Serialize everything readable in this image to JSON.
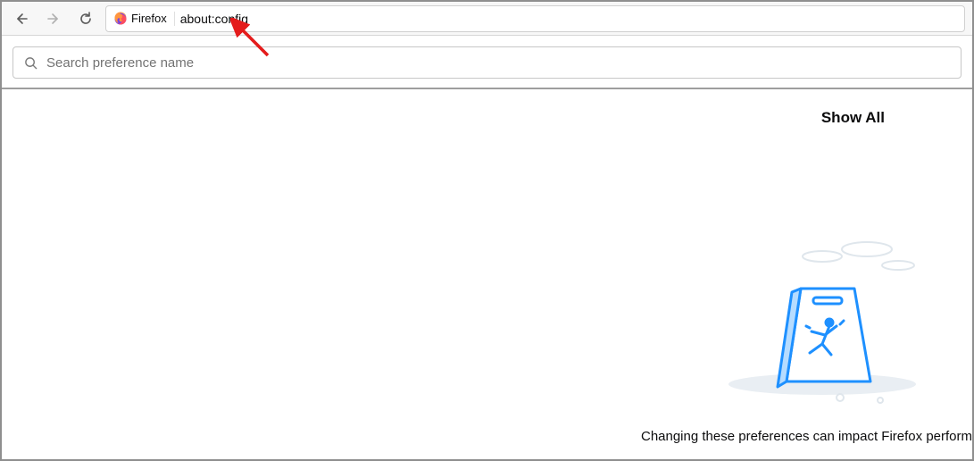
{
  "toolbar": {
    "brand_label": "Firefox",
    "url": "about:config"
  },
  "search": {
    "placeholder": "Search preference name"
  },
  "content": {
    "show_all_label": "Show All",
    "warning_text": "Changing these preferences can impact Firefox perform"
  }
}
